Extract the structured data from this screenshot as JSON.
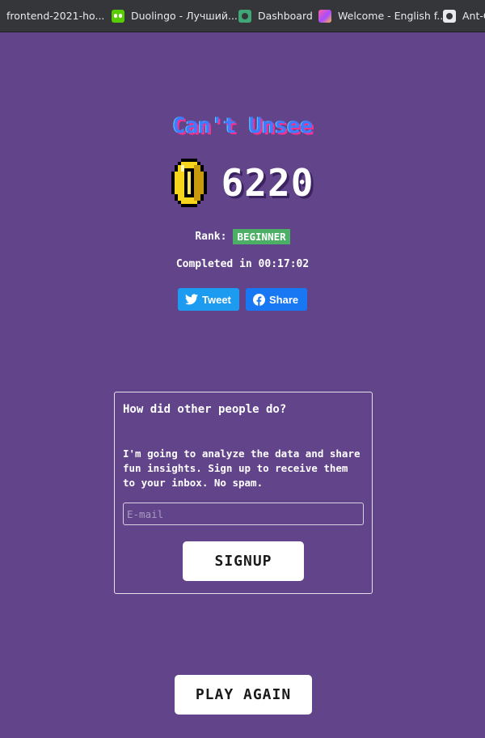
{
  "bookmarks": [
    {
      "label": "frontend-2021-ho...",
      "icon": "none"
    },
    {
      "label": "Duolingo - Лучший...",
      "icon": "duolingo-icon"
    },
    {
      "label": "Dashboard",
      "icon": "dashboard-icon"
    },
    {
      "label": "Welcome - English f...",
      "icon": "welcome-icon"
    },
    {
      "label": "Ant-C",
      "icon": "github-icon"
    }
  ],
  "game": {
    "title": "Can't Unsee",
    "coin_icon": "coin-icon",
    "score": "6220",
    "rank_label": "Rank:",
    "rank_value": "BEGINNER",
    "completed": "Completed in 00:17:02"
  },
  "share": {
    "tweet_label": "Tweet",
    "facebook_label": "Share"
  },
  "signup_card": {
    "heading": "How did other people do?",
    "body": "I'm going to analyze the data and share fun insights. Sign up to receive them to your inbox. No spam.",
    "email_placeholder": "E-mail",
    "email_value": "",
    "button_label": "SIGNUP"
  },
  "play_again_label": "PLAY AGAIN",
  "colors": {
    "background": "#62448a",
    "title": "#3e7bff",
    "title_shadow": "#ff2e8a",
    "rank_badge": "#4caf66",
    "tweet": "#1d9bf0",
    "facebook": "#1877f2",
    "coin": "#f7d51d"
  }
}
